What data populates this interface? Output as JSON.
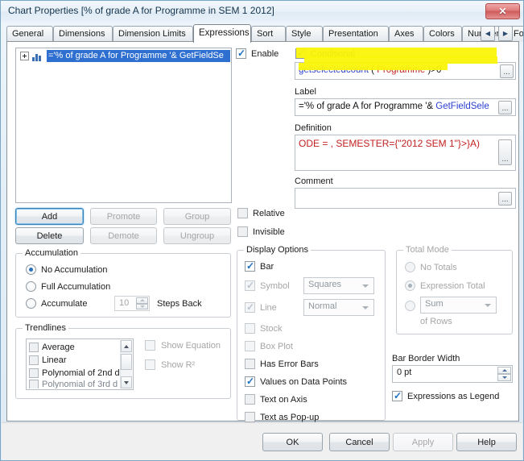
{
  "window": {
    "title": "Chart Properties [% of grade A for Programme  in SEM 1 2012]",
    "close_label": "✕"
  },
  "tabs": {
    "items": [
      {
        "label": "General",
        "active": false
      },
      {
        "label": "Dimensions",
        "active": false
      },
      {
        "label": "Dimension Limits",
        "active": false
      },
      {
        "label": "Expressions",
        "active": true
      },
      {
        "label": "Sort",
        "active": false
      },
      {
        "label": "Style",
        "active": false
      },
      {
        "label": "Presentation",
        "active": false
      },
      {
        "label": "Axes",
        "active": false
      },
      {
        "label": "Colors",
        "active": false
      },
      {
        "label": "Number",
        "active": false
      },
      {
        "label": "Font",
        "active": false
      }
    ],
    "scroll_left": "◀",
    "scroll_right": "▶"
  },
  "expression_list": {
    "selected_item": "='% of grade A for Programme '& GetFieldSe"
  },
  "list_buttons": {
    "add": "Add",
    "delete": "Delete",
    "promote": "Promote",
    "demote": "Demote",
    "group": "Group",
    "ungroup": "Ungroup"
  },
  "enable": {
    "label": "Enable",
    "checked": true
  },
  "conditional": {
    "label": "Conditional",
    "checked": true,
    "value_blue": "getselectedcount",
    "value_paren_open": " ( ",
    "value_red": "Programme",
    "value_tail": " )>0",
    "ellipsis": "..."
  },
  "label_field": {
    "label": "Label",
    "value_black": "='% of grade A for Programme '& ",
    "value_blue": "GetFieldSele",
    "ellipsis": "..."
  },
  "definition_field": {
    "label": "Definition",
    "value": "ODE = , SEMESTER={\"2012 SEM 1\"}>}A)",
    "ellipsis": "..."
  },
  "comment_field": {
    "label": "Comment",
    "value": "",
    "ellipsis": "..."
  },
  "relative": {
    "label": "Relative",
    "checked": false
  },
  "invisible": {
    "label": "Invisible",
    "checked": false
  },
  "accumulation": {
    "title": "Accumulation",
    "no_accumulation": "No Accumulation",
    "full_accumulation": "Full Accumulation",
    "accumulate": "Accumulate",
    "steps_value": "10",
    "steps_back": "Steps Back",
    "selected": "no_accumulation"
  },
  "trendlines": {
    "title": "Trendlines",
    "items": [
      "Average",
      "Linear",
      "Polynomial of 2nd d",
      "Polynomial of 3rd d"
    ],
    "show_equation": "Show Equation",
    "show_r2": "Show R²"
  },
  "display_options": {
    "title": "Display Options",
    "bar": {
      "label": "Bar",
      "checked": true,
      "enabled": true
    },
    "symbol": {
      "label": "Symbol",
      "checked": true,
      "enabled": false,
      "combo": "Squares"
    },
    "line": {
      "label": "Line",
      "checked": true,
      "enabled": false,
      "combo": "Normal"
    },
    "stock": {
      "label": "Stock",
      "checked": false,
      "enabled": false
    },
    "box_plot": {
      "label": "Box Plot",
      "checked": false,
      "enabled": false
    },
    "has_error_bars": {
      "label": "Has Error Bars",
      "checked": false,
      "enabled": true
    },
    "values_on_data_points": {
      "label": "Values on Data Points",
      "checked": true,
      "enabled": true
    },
    "text_on_axis": {
      "label": "Text on Axis",
      "checked": false,
      "enabled": true
    },
    "text_as_popup": {
      "label": "Text as Pop-up",
      "checked": false,
      "enabled": true
    }
  },
  "total_mode": {
    "title": "Total Mode",
    "no_totals": "No Totals",
    "expression_total": "Expression Total",
    "aggregation": "Sum",
    "of_rows": "of Rows",
    "selected": "expression_total",
    "enabled": false
  },
  "bar_border_width": {
    "label": "Bar Border Width",
    "value": "0 pt"
  },
  "expressions_as_legend": {
    "label": "Expressions as Legend",
    "checked": true
  },
  "footer_buttons": {
    "ok": "OK",
    "cancel": "Cancel",
    "apply": "Apply",
    "help": "Help"
  }
}
